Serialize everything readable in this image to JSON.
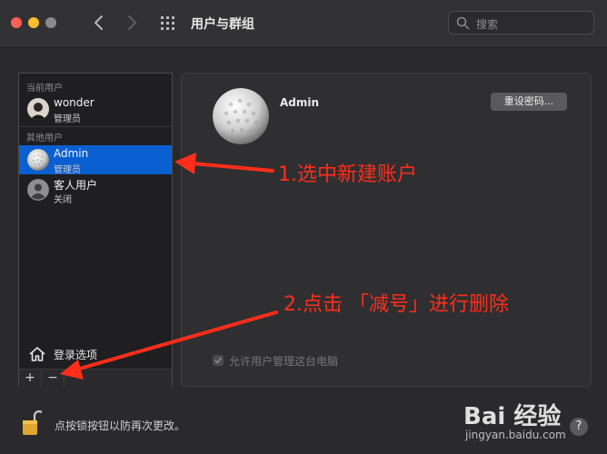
{
  "window": {
    "title": "用户与群组",
    "search_placeholder": "搜索"
  },
  "sidebar": {
    "current_header": "当前用户",
    "other_header": "其他用户",
    "current_user": {
      "name": "wonder",
      "role": "管理员"
    },
    "other_users": [
      {
        "name": "Admin",
        "role": "管理员",
        "selected": true
      },
      {
        "name": "客人用户",
        "role": "关闭",
        "selected": false
      }
    ],
    "login_options_label": "登录选项",
    "add_label": "+",
    "remove_label": "−"
  },
  "detail": {
    "name": "Admin",
    "reset_password_label": "重设密码...",
    "allow_admin_label": "允许用户管理这台电脑",
    "allow_admin_checked": true
  },
  "footer": {
    "lock_text": "点按锁按钮以防再次更改。",
    "help_label": "?"
  },
  "annotations": {
    "step1": "1.选中新建账户",
    "step2": "2.点击 「减号」进行删除"
  },
  "watermark": {
    "logo": "Bai 经验",
    "url": "jingyan.baidu.com"
  },
  "colors": {
    "selection": "#0a5fd1",
    "annotation": "#ff2d1a",
    "close": "#ff5f57",
    "minimize": "#febc2e"
  },
  "icons": [
    "chevron-left-icon",
    "chevron-right-icon",
    "grid-icon",
    "search-icon",
    "home-icon",
    "lock-icon",
    "checkmark-icon"
  ]
}
